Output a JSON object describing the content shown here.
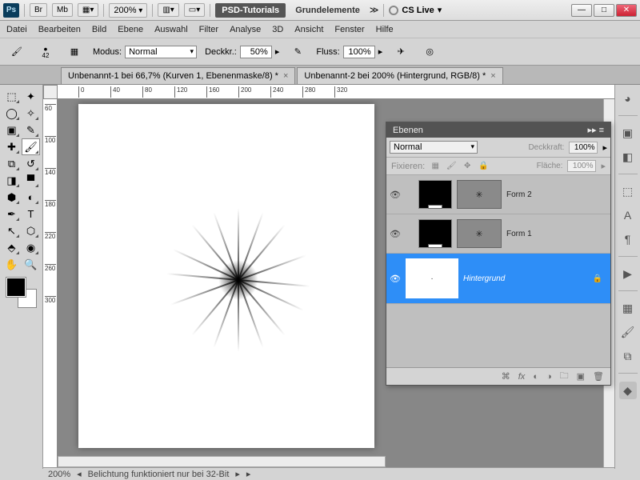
{
  "top": {
    "ps": "Ps",
    "br": "Br",
    "mb": "Mb",
    "zoom": "200%",
    "tutorials": "PSD-Tutorials",
    "grund": "Grundelemente",
    "cslive": "CS Live"
  },
  "menu": [
    "Datei",
    "Bearbeiten",
    "Bild",
    "Ebene",
    "Auswahl",
    "Filter",
    "Analyse",
    "3D",
    "Ansicht",
    "Fenster",
    "Hilfe"
  ],
  "opt": {
    "brush_size": "42",
    "modus_label": "Modus:",
    "modus_value": "Normal",
    "deck_label": "Deckkr.:",
    "deck_value": "50%",
    "fluss_label": "Fluss:",
    "fluss_value": "100%"
  },
  "tabs": [
    {
      "title": "Unbenannt-1 bei 66,7% (Kurven 1, Ebenenmaske/8) *",
      "active": false
    },
    {
      "title": "Unbenannt-2 bei 200% (Hintergrund, RGB/8) *",
      "active": true
    }
  ],
  "ruler_h": [
    "0",
    "40",
    "80",
    "120",
    "160",
    "200",
    "240",
    "280",
    "320"
  ],
  "ruler_v": [
    "60",
    "100",
    "140",
    "180",
    "220",
    "260",
    "300"
  ],
  "layers_panel": {
    "title": "Ebenen",
    "blend": "Normal",
    "deck_label": "Deckkraft:",
    "deck_value": "100%",
    "fix_label": "Fixieren:",
    "area_label": "Fläche:",
    "area_value": "100%",
    "layers": [
      {
        "name": "Form 2",
        "sel": false,
        "mask": "✳"
      },
      {
        "name": "Form 1",
        "sel": false,
        "mask": "✳"
      },
      {
        "name": "Hintergrund",
        "sel": true,
        "locked": true
      }
    ]
  },
  "status": {
    "zoom": "200%",
    "msg": "Belichtung funktioniert nur bei 32-Bit"
  }
}
